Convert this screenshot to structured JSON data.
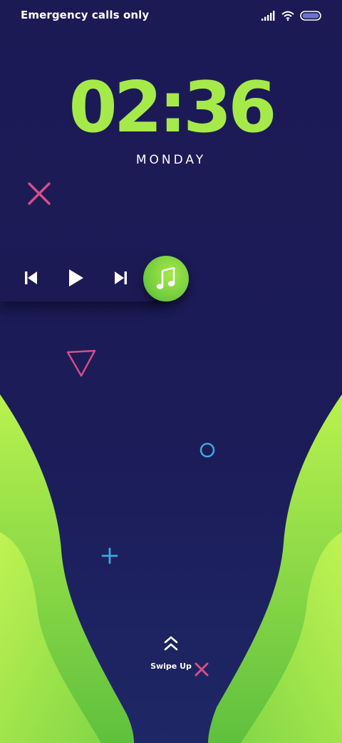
{
  "status_bar": {
    "carrier_text": "Emergency calls only",
    "icons": [
      "signal-icon",
      "wifi-icon",
      "battery-icon"
    ]
  },
  "lock_screen": {
    "time": "02:36",
    "weekday": "MONDAY"
  },
  "music_widget": {
    "controls": [
      "previous-icon",
      "play-icon",
      "next-icon",
      "music-note-icon"
    ]
  },
  "swipe": {
    "label": "Swipe Up"
  },
  "colors": {
    "background": "#1b1a52",
    "clock_accent": "#a6ea4a",
    "wave_green_light": "#b6f04e",
    "wave_green_dark": "#4cb73a",
    "deco_pink": "#d84f82",
    "deco_blue": "#3fa7e0"
  }
}
